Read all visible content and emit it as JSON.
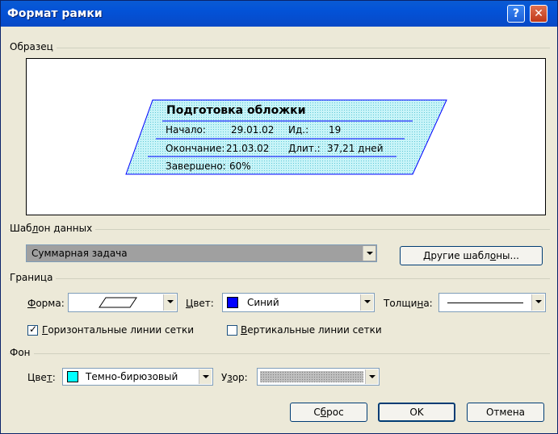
{
  "title": "Формат рамки",
  "icons": {
    "help": "?",
    "close": "✕"
  },
  "sample": {
    "label": "Образец",
    "task_name": "Подготовка обложки",
    "start_label": "Начало:",
    "start_value": "29.01.02",
    "id_label": "Ид.:",
    "id_value": "19",
    "finish_label": "Окончание:",
    "finish_value": "21.03.02",
    "duration_label": "Длит.:",
    "duration_value": "37,21 дней",
    "complete_label": "Завершено:",
    "complete_value": "60%"
  },
  "template": {
    "label_pre": "Шаб",
    "label_u": "л",
    "label_post": "он данных",
    "selected": "Суммарная задача",
    "more_pre": "Другие шабл",
    "more_u": "о",
    "more_post": "ны..."
  },
  "border": {
    "label": "Граница",
    "shape_u": "Ф",
    "shape_post": "орма:",
    "color_u": "Ц",
    "color_post": "вет:",
    "color_value": "Синий",
    "color_hex": "#0000ff",
    "thickness_pre": "Толщи",
    "thickness_u": "н",
    "thickness_post": "а:",
    "hgrid_u": "Г",
    "hgrid_post": "оризонтальные линии сетки",
    "vgrid_u": "В",
    "vgrid_post": "ертикальные линии сетки"
  },
  "background": {
    "label": "Фон",
    "color_pre": "Цве",
    "color_u": "т",
    "color_post": ":",
    "color_value": "Темно-бирюзовый",
    "color_hex": "#00ffff",
    "pattern_pre": "У",
    "pattern_u": "з",
    "pattern_post": "ор:"
  },
  "buttons": {
    "reset_pre": "С",
    "reset_u": "б",
    "reset_post": "рос",
    "ok": "OK",
    "cancel": "Отмена"
  }
}
